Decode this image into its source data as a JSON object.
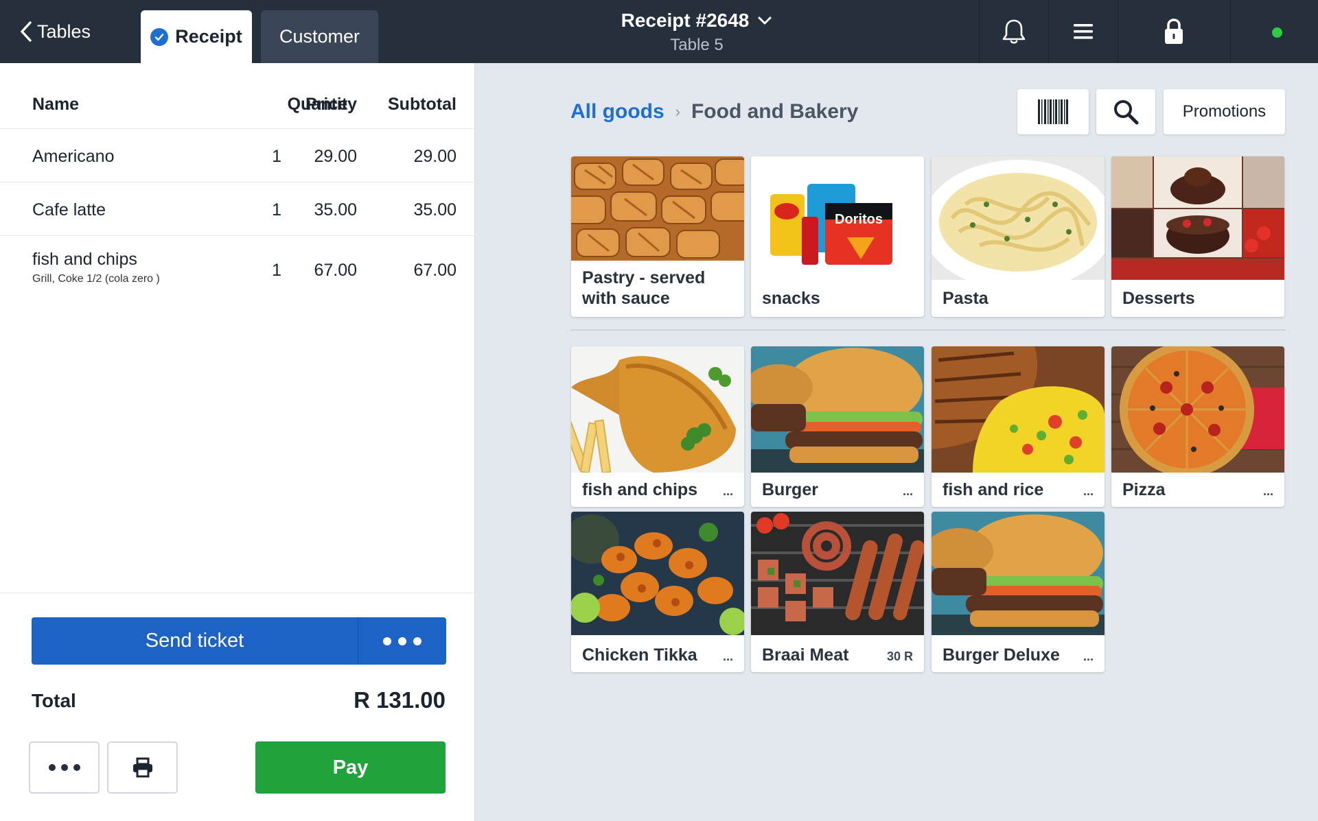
{
  "topbar": {
    "back_label": "Tables",
    "tabs": [
      {
        "label": "Receipt",
        "active": true
      },
      {
        "label": "Customer",
        "active": false
      }
    ],
    "receipt_title": "Receipt #2648",
    "table_label": "Table 5",
    "icons": [
      "bell-icon",
      "menu-icon",
      "lock-icon",
      "status-dot"
    ]
  },
  "receipt": {
    "columns": {
      "name": "Name",
      "quantity": "Quantity",
      "price": "Price",
      "subtotal": "Subtotal"
    },
    "items": [
      {
        "name": "Americano",
        "modifiers": "",
        "quantity": "1",
        "price": "29.00",
        "subtotal": "29.00"
      },
      {
        "name": "Cafe latte",
        "modifiers": "",
        "quantity": "1",
        "price": "35.00",
        "subtotal": "35.00"
      },
      {
        "name": "fish and chips",
        "modifiers": "Grill, Coke 1/2 (cola zero )",
        "quantity": "1",
        "price": "67.00",
        "subtotal": "67.00"
      }
    ],
    "send_ticket_label": "Send ticket",
    "total_label": "Total",
    "total_value": "R 131.00",
    "pay_label": "Pay"
  },
  "catalog": {
    "breadcrumb": {
      "root": "All goods",
      "current": "Food and Bakery"
    },
    "promotions_label": "Promotions",
    "categories": [
      {
        "name": "Pastry - served with sauce"
      },
      {
        "name": "snacks"
      },
      {
        "name": "Pasta"
      },
      {
        "name": "Desserts"
      }
    ],
    "products": [
      {
        "name": "fish and chips",
        "meta": "..."
      },
      {
        "name": "Burger",
        "meta": "..."
      },
      {
        "name": "fish and rice",
        "meta": "..."
      },
      {
        "name": "Pizza",
        "meta": "..."
      },
      {
        "name": "Chicken Tikka",
        "meta": "..."
      },
      {
        "name": "Braai Meat",
        "meta": "30 R"
      },
      {
        "name": "Burger Deluxe",
        "meta": "..."
      }
    ]
  },
  "colors": {
    "topbar": "#26303d",
    "accent_blue": "#1c63c5",
    "pay_green": "#1fa33a",
    "status_green": "#2ecc40"
  }
}
